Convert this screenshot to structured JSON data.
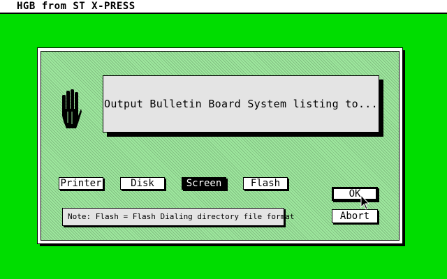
{
  "window": {
    "title": "HGB from ST X-PRESS"
  },
  "dialog": {
    "message": "Output Bulletin Board System listing to...",
    "options": [
      {
        "label": "Printer",
        "selected": false
      },
      {
        "label": "Disk",
        "selected": false
      },
      {
        "label": "Screen",
        "selected": true
      },
      {
        "label": "Flash",
        "selected": false
      }
    ],
    "note": "Note:  Flash = Flash Dialing directory file format",
    "ok_label": "OK",
    "abort_label": "Abort"
  },
  "icons": {
    "alert": "hand-icon",
    "pointer": "mouse-cursor-icon"
  },
  "colors": {
    "desktop": "#00dd00",
    "dialog_fill": "#9ee89e",
    "selected_button": "#000000"
  }
}
